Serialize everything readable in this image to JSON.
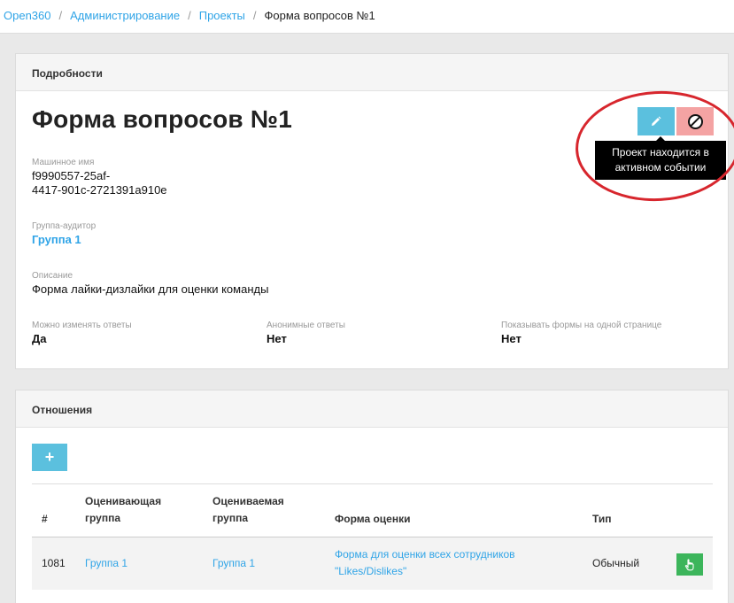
{
  "breadcrumb": {
    "items": [
      "Open360",
      "Администрирование",
      "Проекты"
    ],
    "active": "Форма вопросов №1",
    "separator": "/"
  },
  "details": {
    "panel_title": "Подробности",
    "title": "Форма вопросов №1",
    "machine_name_label": "Машинное имя",
    "machine_name_line1": "f9990557-25af-",
    "machine_name_line2": "4417-901c-2721391a910e",
    "auditor_group_label": "Группа-аудитор",
    "auditor_group_value": "Группа 1",
    "description_label": "Описание",
    "description_value": "Форма лайки-дизлайки для оценки команды",
    "can_change_label": "Можно изменять ответы",
    "can_change_value": "Да",
    "anonymous_label": "Анонимные ответы",
    "anonymous_value": "Нет",
    "one_page_label": "Показывать формы на одной странице",
    "one_page_value": "Нет",
    "edit_icon": "pencil-icon",
    "delete_icon": "ban-icon",
    "tooltip_line1": "Проект находится в",
    "tooltip_line2": "активном событии"
  },
  "relations": {
    "panel_title": "Отношения",
    "add_label": "+",
    "columns": {
      "num": "#",
      "rater_1": "Оценивающая",
      "rater_2": "группа",
      "rated_1": "Оцениваемая",
      "rated_2": "группа",
      "form": "Форма оценки",
      "type": "Тип"
    },
    "rows": [
      {
        "num": "1081",
        "rater": "Группа 1",
        "rated": "Группа 1",
        "form_line1": "Форма для оценки всех сотрудников",
        "form_line2": "\"Likes/Dislikes\"",
        "type": "Обычный",
        "action_icon": "hand-pointer-icon"
      }
    ]
  },
  "colors": {
    "link": "#2fa4e7",
    "info_button": "#5bc0de",
    "danger_button_disabled": "#f4a3a3",
    "success_button": "#3cb55b",
    "annotation_circle": "#d7262d"
  }
}
